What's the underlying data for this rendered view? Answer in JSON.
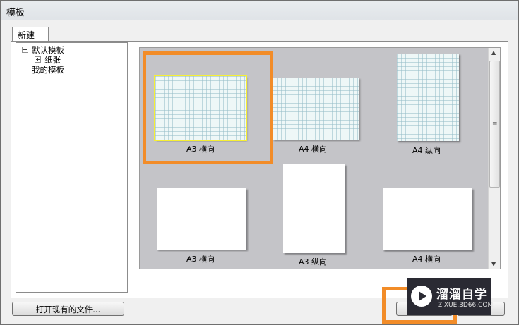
{
  "window": {
    "title": "模板"
  },
  "tabs": [
    {
      "label": "新建"
    }
  ],
  "tree": {
    "root": {
      "label": "默认模板"
    },
    "child": {
      "label": "纸张"
    },
    "sibling": {
      "label": "我的模板"
    }
  },
  "templates": [
    {
      "label": "A3 横向",
      "style": "grid",
      "selected": true
    },
    {
      "label": "A4 横向",
      "style": "grid",
      "selected": false
    },
    {
      "label": "A4 纵向",
      "style": "grid",
      "selected": false
    },
    {
      "label": "A3 横向",
      "style": "blank",
      "selected": false
    },
    {
      "label": "A3 纵向",
      "style": "blank",
      "selected": false
    },
    {
      "label": "A4 横向",
      "style": "blank",
      "selected": false
    }
  ],
  "buttons": {
    "open_existing": "打开现有的文件..."
  },
  "watermark": {
    "name": "溜溜自学",
    "url": "ZIXUE.3D66.COM"
  },
  "colors": {
    "highlight": "#f28c28",
    "selection": "#f6ef33",
    "gallery_bg": "#c4c4c8"
  }
}
